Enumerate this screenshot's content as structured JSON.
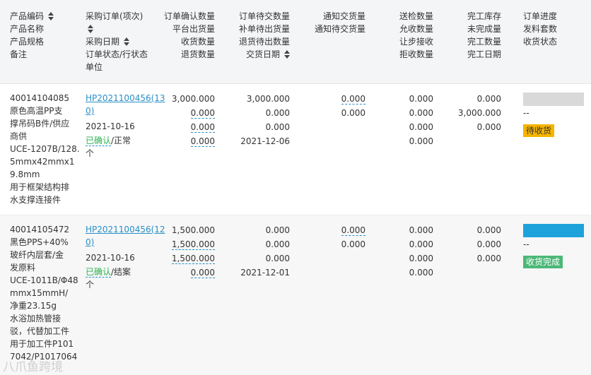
{
  "headers": {
    "col1": [
      "产品编码",
      "产品名称",
      "产品规格",
      "备注"
    ],
    "col2": [
      "采购订单(项次)",
      "采购日期",
      "订单状态/行状态",
      "单位"
    ],
    "col3": [
      "订单确认数量",
      "平台出货量",
      "收货数量",
      "退货数量"
    ],
    "col4": [
      "订单待交数量",
      "补单待出货量",
      "退货待出数量",
      "交货日期"
    ],
    "col5": [
      "通知交货量",
      "通知待交货量"
    ],
    "col6": [
      "送检数量",
      "允收数量",
      "让步接收",
      "拒收数量"
    ],
    "col7": [
      "完工库存",
      "未完成量",
      "完工数量",
      "完工日期"
    ],
    "col8": [
      "订单进度",
      "发料套数",
      "收货状态"
    ]
  },
  "rows": [
    {
      "product_lines": [
        "40014104085",
        "原色高温PP支",
        "撑吊码B件/供应",
        "商供",
        "UCE-1207B/128.",
        "5mmx42mmx1",
        "9.8mm",
        "用于框架结构排",
        "水支撑连接件"
      ],
      "order_link": [
        "HP2021100456(13",
        "0)"
      ],
      "date": "2021-10-16",
      "status_confirmed": "已确认",
      "status_rest": "/正常",
      "unit": "个",
      "col3": [
        "3,000.000",
        "0.000",
        "0.000",
        "0.000"
      ],
      "col4": [
        "3,000.000",
        "0.000",
        "0.000",
        "2021-12-06"
      ],
      "col5": [
        "0.000",
        "0.000"
      ],
      "col6": [
        "0.000",
        "0.000",
        "0.000",
        "0.000"
      ],
      "col7": [
        "0.000",
        "3,000.000",
        "0.000"
      ],
      "progress_color": "#d9d9d9",
      "kit_sets": "--",
      "badge": "待收货",
      "badge_color": "#f5b400"
    },
    {
      "product_lines": [
        "40014105472",
        "黑色PPS+40%",
        "玻纤内层套/金",
        "发原料",
        "UCE-1011B/Φ48",
        "mmx15mmH/",
        "净重23.15g",
        "水浴加热管接",
        "驳，代替加工件",
        "用于加工件P101",
        "7042/P1017064"
      ],
      "order_link": [
        "HP2021100456(12",
        "0)"
      ],
      "date": "2021-10-16",
      "status_confirmed": "已确认",
      "status_rest": "/结案",
      "unit": "个",
      "col3": [
        "1,500.000",
        "1,500.000",
        "1,500.000",
        "0.000"
      ],
      "col4": [
        "0.000",
        "0.000",
        "0.000",
        "2021-12-01"
      ],
      "col5": [
        "0.000",
        "0.000"
      ],
      "col6": [
        "0.000",
        "0.000",
        "0.000",
        "0.000"
      ],
      "col7": [
        "0.000",
        "0.000",
        "0.000"
      ],
      "progress_color": "#1ea2dc",
      "kit_sets": "--",
      "badge": "收货完成",
      "badge_color": "#4cb878"
    }
  ],
  "watermark": "八爪鱼跨境"
}
